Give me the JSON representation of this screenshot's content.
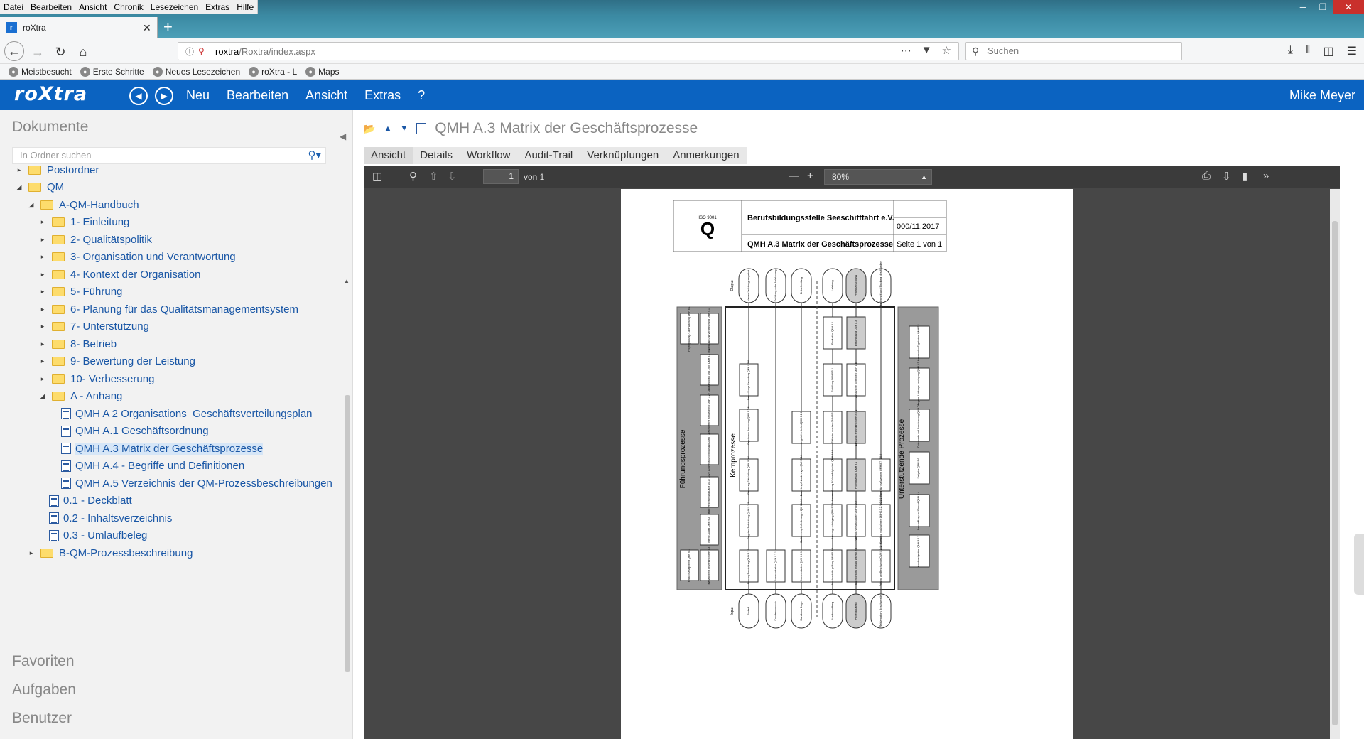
{
  "browser": {
    "menu": [
      "Datei",
      "Bearbeiten",
      "Ansicht",
      "Chronik",
      "Lesezeichen",
      "Extras",
      "Hilfe"
    ],
    "tab_title": "roXtra",
    "url_host": "roxtra",
    "url_path": "/Roxtra/index.aspx",
    "search_placeholder": "Suchen",
    "bookmarks": [
      "Meistbesucht",
      "Erste Schritte",
      "Neues Lesezeichen",
      "roXtra - L",
      "Maps"
    ]
  },
  "app": {
    "logo": "roXtra",
    "menu": [
      "Neu",
      "Bearbeiten",
      "Ansicht",
      "Extras",
      "?"
    ],
    "user": "Mike Meyer"
  },
  "sidebar": {
    "title": "Dokumente",
    "search_placeholder": "In Ordner suchen",
    "tree": [
      {
        "label": "Postordner",
        "level": 1,
        "type": "folder",
        "twisty": "▸"
      },
      {
        "label": "QM",
        "level": 1,
        "type": "folder",
        "twisty": "◢"
      },
      {
        "label": "A-QM-Handbuch",
        "level": 2,
        "type": "folder",
        "twisty": "◢"
      },
      {
        "label": "1- Einleitung",
        "level": 3,
        "type": "folder",
        "twisty": "▸"
      },
      {
        "label": "2- Qualitätspolitik",
        "level": 3,
        "type": "folder",
        "twisty": "▸"
      },
      {
        "label": "3- Organisation und Verantwortung",
        "level": 3,
        "type": "folder",
        "twisty": "▸"
      },
      {
        "label": "4- Kontext der Organisation",
        "level": 3,
        "type": "folder",
        "twisty": "▸"
      },
      {
        "label": "5- Führung",
        "level": 3,
        "type": "folder",
        "twisty": "▸"
      },
      {
        "label": "6- Planung für das Qualitätsmanagementsystem",
        "level": 3,
        "type": "folder",
        "twisty": "▸"
      },
      {
        "label": "7- Unterstützung",
        "level": 3,
        "type": "folder",
        "twisty": "▸"
      },
      {
        "label": "8- Betrieb",
        "level": 3,
        "type": "folder",
        "twisty": "▸"
      },
      {
        "label": "9- Bewertung der Leistung",
        "level": 3,
        "type": "folder",
        "twisty": "▸"
      },
      {
        "label": "10- Verbesserung",
        "level": 3,
        "type": "folder",
        "twisty": "▸"
      },
      {
        "label": "A - Anhang",
        "level": 3,
        "type": "folder",
        "twisty": "◢"
      },
      {
        "label": "QMH A 2 Organisations_Geschäftsverteilungsplan",
        "level": 4,
        "type": "doc",
        "twisty": ""
      },
      {
        "label": "QMH A.1 Geschäftsordnung",
        "level": 4,
        "type": "doc",
        "twisty": ""
      },
      {
        "label": "QMH A.3 Matrix der Geschäftsprozesse",
        "level": 4,
        "type": "doc",
        "twisty": "",
        "selected": true
      },
      {
        "label": "QMH A.4 - Begriffe und Definitionen",
        "level": 4,
        "type": "doc",
        "twisty": ""
      },
      {
        "label": "QMH A.5 Verzeichnis der QM-Prozessbeschreibungen",
        "level": 4,
        "type": "doc",
        "twisty": ""
      },
      {
        "label": "0.1 - Deckblatt",
        "level": 3,
        "type": "doc",
        "twisty": ""
      },
      {
        "label": "0.2 - Inhaltsverzeichnis",
        "level": 3,
        "type": "doc",
        "twisty": ""
      },
      {
        "label": "0.3 - Umlaufbeleg",
        "level": 3,
        "type": "doc",
        "twisty": ""
      },
      {
        "label": "B-QM-Prozessbeschreibung",
        "level": 2,
        "type": "folder",
        "twisty": "▸"
      }
    ],
    "sections": [
      "Favoriten",
      "Aufgaben",
      "Benutzer"
    ]
  },
  "main": {
    "title": "QMH A.3 Matrix der Geschäftsprozesse",
    "tabs": [
      "Ansicht",
      "Details",
      "Workflow",
      "Audit-Trail",
      "Verknüpfungen",
      "Anmerkungen"
    ],
    "active_tab": "Ansicht",
    "viewer": {
      "page": "1",
      "of": "von 1",
      "zoom": "80%"
    }
  },
  "doc_header": {
    "iso": "ISO 9001",
    "org": "Berufsbildungsstelle Seeschifffahrt e.V.",
    "date": "000/11.2017",
    "title": "QMH A.3  Matrix der Geschäftsprozesse",
    "page": "Seite 1 von 1"
  },
  "diagram": {
    "output_label": "Output",
    "input_label": "Input",
    "left_band": "Führungsprozesse",
    "center_band": "Kernprozesse",
    "right_band": "Unterstützende Prozesse",
    "outputs": [
      "Neues Leistungsangebot",
      "Erfüllung oder Ablehnung",
      "Entscheidung",
      "Leistung",
      "Projektabschluss",
      "Zufriedenheit und Bindung des Kunden"
    ],
    "inputs": [
      "Bedarf",
      "Kundenwunsch",
      "Kundenanfrage",
      "Kundenauftrag",
      "Projektauftrag",
      "Reklamation Beschwerde"
    ],
    "left_boxes": [
      "Projektplanung / -überwachung QMH 6.1",
      "Lenkung und Verbesserung QMH 4.1",
      "Qualitätspolitik und -ziele QMH 2.1 / 6.2",
      "Kompetenz Bewusstsein QMH 7.2 / 7.3",
      "Ressourcen planung QMH 7.1",
      "Strategie Verbesserung QMH 10.1 / 10.2 / 10.3",
      "Interne Audits QMH 9.2",
      "Risiko management QMH 6.1",
      "Management bewertung QMH 9.3"
    ],
    "right_boxes": [
      "Kennzahlen Ergebnisse QMH 9.1",
      "Telegram Leistungs-erbringung QMH 8.5",
      "Dokumente und Aufzeichnung QMH 7.5",
      "Freigabe QMH 8.6",
      "Beschaffung und Einkauf QMH 8.4",
      "Kundeneigentum QMH 8.5.3"
    ],
    "core_col1": [
      "Entwicklungs Bewertung QMH 8.3.6",
      "Ergebnisse Bewertung QMH 8.3.5",
      "Steuerung Entwicklung QMH 8.3.4",
      "Eingaben Entwicklung QMH 8.3.3",
      "Planung Entwicklung QMH 8.3.2"
    ],
    "core_col2": [
      "Kommunikation QMH 8.2.1"
    ],
    "core_col3": [
      "Angebot erstellen QMH 8.2.1",
      "Bewertung Anforderungen QMH 8.2.3",
      "Bestimmung Anforderungen QMH 8.2.2",
      "Kommunikation QMH 8.2.1"
    ],
    "core_col4": [
      "Produktion QMH 8.5",
      "Erstellung QMH 8.5.4",
      "Zufrieden machen QMH 8.6",
      "Kennzeichnung Rückverfolgbarkeit QMH 8.5.2",
      "Leistungs erbringung QMH 8.5.1",
      "Machbarkeits prüfung QMH 8.2.3"
    ],
    "core_col5": [
      "Entscheidung QMH 8.3",
      "Zusätzliche Kontrollen QMH 8.6",
      "Leistungs erbringung QMH 8.5.1",
      "Projektplanung QMH 8.1",
      "Vertrags verhandlungen QMH 8.2.3",
      "Machbarkeits prüfung QMH 8.2.3"
    ],
    "core_col6": [
      "Korrektur maßnahmen QMH 8.7 / 10.2",
      "Korrektur maßnahmen QMH 10.2 / 10.1.1",
      "Prüfung der Beschwerde QMH 8.2.1"
    ]
  }
}
